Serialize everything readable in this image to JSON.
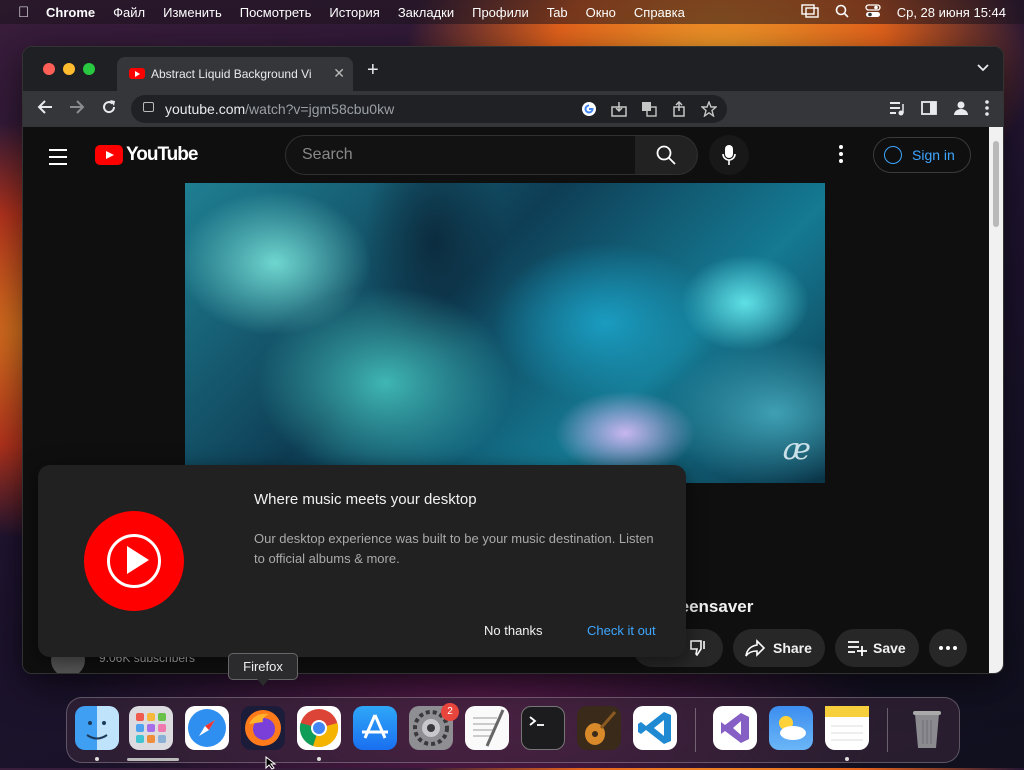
{
  "menubar": {
    "apple": "",
    "app": "Chrome",
    "items": [
      "Файл",
      "Изменить",
      "Посмотреть",
      "История",
      "Закладки",
      "Профили",
      "Tab",
      "Окно",
      "Справка"
    ],
    "clock": "Ср, 28 июня  15:44"
  },
  "browser": {
    "tab_title": "Abstract Liquid Background Vi",
    "tab_close": "✕",
    "new_tab": "+",
    "url_host": "youtube.com",
    "url_path": "/watch?v=jgm58cbu0kw"
  },
  "youtube": {
    "logo": "YouTube",
    "search_placeholder": "Search",
    "sign_in": "Sign in",
    "video_title_fragment": "reensaver",
    "subscribers": "9.06K subscribers",
    "actions": {
      "share": "Share",
      "save": "Save"
    },
    "watermark": "æ",
    "brand_color": "#ff0000",
    "link_color": "#3ea6ff"
  },
  "popup": {
    "heading": "Where music meets your desktop",
    "description": "Our desktop experience was built to be your music destination. Listen to official albums & more.",
    "dismiss": "No thanks",
    "confirm": "Check it out"
  },
  "tooltip": "Firefox",
  "dock": {
    "badge_count": "2",
    "apps": [
      "finder",
      "launchpad",
      "safari",
      "firefox",
      "chrome",
      "app-store",
      "system-settings",
      "textedit",
      "terminal",
      "garageband",
      "vscode",
      "visual-studio",
      "weather",
      "notes",
      "trash"
    ]
  }
}
